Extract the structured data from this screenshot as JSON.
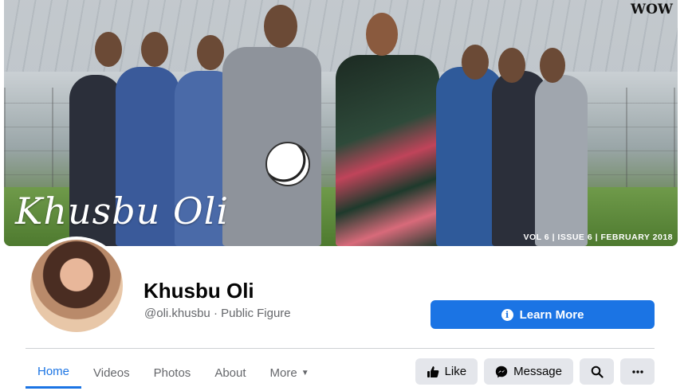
{
  "cover": {
    "title": "Khusbu Oli",
    "issue": "VOL 6 | ISSUE 6 | FEBRUARY 2018",
    "brand": "WOW"
  },
  "profile": {
    "name": "Khusbu Oli",
    "handle_line": "@oli.khusbu · Public Figure"
  },
  "cta": {
    "label": "Learn More",
    "icon": "info-icon"
  },
  "tabs": [
    {
      "label": "Home",
      "active": true
    },
    {
      "label": "Videos"
    },
    {
      "label": "Photos"
    },
    {
      "label": "About"
    },
    {
      "label": "More",
      "has_dropdown": true
    }
  ],
  "actions": {
    "like_label": "Like",
    "message_label": "Message",
    "search_icon": "search-icon",
    "more_icon": "more-icon"
  },
  "colors": {
    "accent": "#1b74e4",
    "button_bg": "#e4e6eb",
    "muted_text": "#65676b"
  }
}
